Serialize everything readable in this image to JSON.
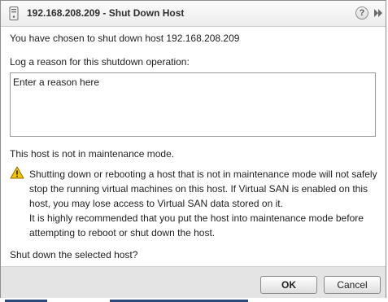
{
  "dialog": {
    "title": "192.168.208.209 - Shut Down Host",
    "icons": {
      "host": "host-server-icon",
      "help": "help-icon",
      "expand": "double-chevron-right-icon"
    },
    "help_glyph": "?",
    "intro_text": "You have chosen to shut down host 192.168.208.209",
    "reason_label": "Log a reason for this shutdown operation:",
    "reason_placeholder": "Enter a reason here",
    "reason_value": "",
    "maintenance_status": "This host is not in maintenance mode.",
    "warning_icon": "warning-triangle-icon",
    "warning_paragraphs": [
      "Shutting down or rebooting a host that is not in maintenance mode will not safely stop the running virtual machines on this host. If Virtual SAN is enabled on this host, you may lose access to Virtual SAN data stored on it.",
      "It is highly recommended that you put the host into maintenance mode before attempting to reboot or shut down the host."
    ],
    "confirm_question": "Shut down the selected host?",
    "buttons": {
      "ok": "OK",
      "cancel": "Cancel"
    }
  },
  "colors": {
    "titlebar": "#ececec",
    "footer": "#e4e4e4",
    "warning_yellow": "#f5c400",
    "border": "#8e8e8e"
  }
}
